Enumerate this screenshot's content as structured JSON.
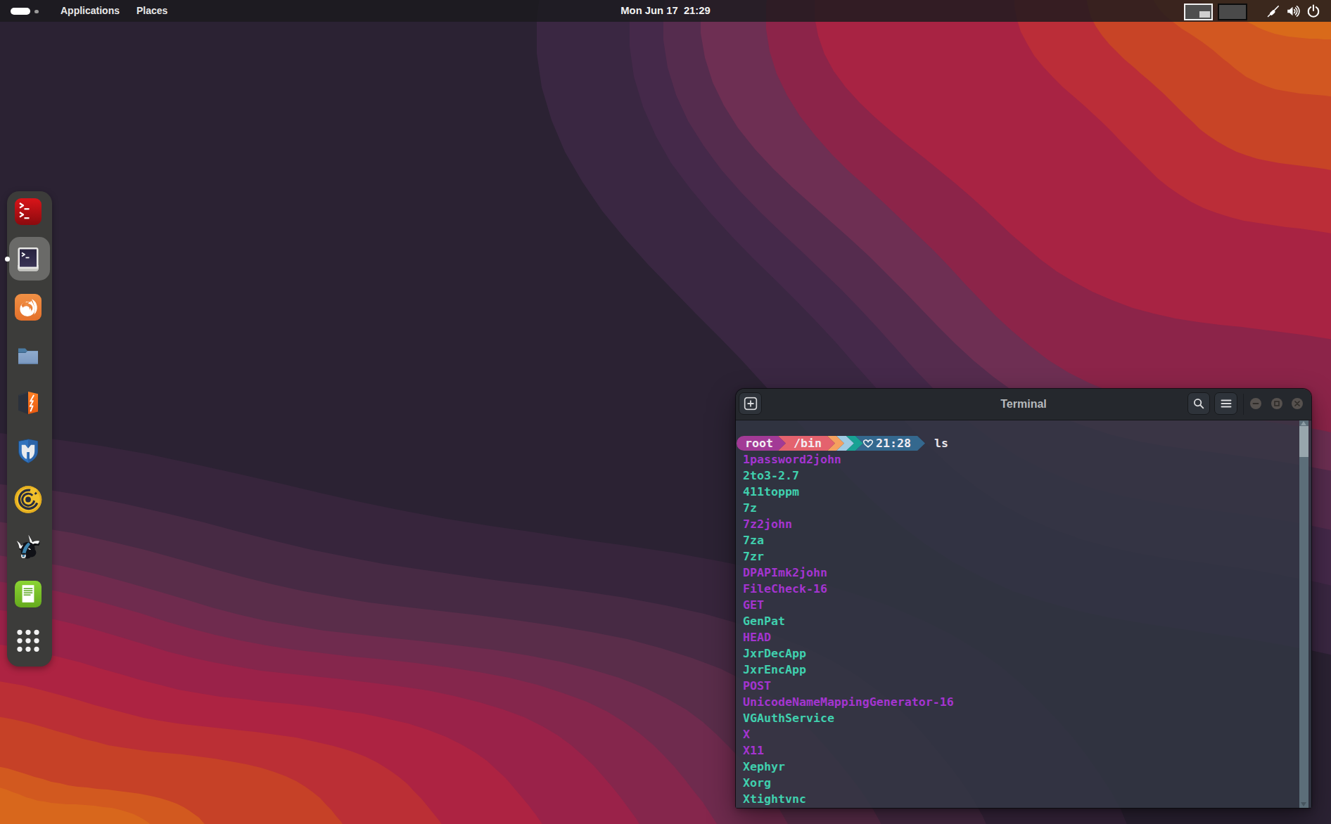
{
  "theme": {
    "panel_bg": "rgba(26,26,30,0.83)",
    "dock_bg": "#3c3c3a",
    "terminal_header_bg": "#25282d",
    "terminal_body_bg": "rgba(49,54,67,0.85)",
    "accent_magenta": "#a434d0",
    "accent_teal": "#40d0ae",
    "wallpaper_orange": "#dc7418",
    "wallpaper_crimson": "#a62343",
    "wallpaper_dark": "#2a2132"
  },
  "topbar": {
    "menus": [
      {
        "label": "Applications"
      },
      {
        "label": "Places"
      }
    ],
    "clock": "Mon Jun 17  21:29",
    "icons": [
      "stylus-icon",
      "volume-icon",
      "power-icon"
    ]
  },
  "dock": {
    "icons": [
      "root-terminal-icon",
      "terminal-icon",
      "firefox-icon",
      "files-icon",
      "burpsuite-icon",
      "metasploit-icon",
      "caido-icon",
      "beef-icon",
      "notes-icon",
      "show-apps-icon"
    ]
  },
  "terminal": {
    "title": "Terminal",
    "prompt": {
      "user": "root",
      "dir": "/bin",
      "heart": "♡",
      "time": "21:28",
      "command": "ls"
    },
    "files": [
      {
        "name": "1password2john",
        "color": "magenta"
      },
      {
        "name": "2to3-2.7",
        "color": "teal"
      },
      {
        "name": "411toppm",
        "color": "teal"
      },
      {
        "name": "7z",
        "color": "teal"
      },
      {
        "name": "7z2john",
        "color": "magenta"
      },
      {
        "name": "7za",
        "color": "teal"
      },
      {
        "name": "7zr",
        "color": "teal"
      },
      {
        "name": "DPAPImk2john",
        "color": "magenta"
      },
      {
        "name": "FileCheck-16",
        "color": "magenta"
      },
      {
        "name": "GET",
        "color": "magenta"
      },
      {
        "name": "GenPat",
        "color": "teal"
      },
      {
        "name": "HEAD",
        "color": "magenta"
      },
      {
        "name": "JxrDecApp",
        "color": "teal"
      },
      {
        "name": "JxrEncApp",
        "color": "teal"
      },
      {
        "name": "POST",
        "color": "magenta"
      },
      {
        "name": "UnicodeNameMappingGenerator-16",
        "color": "magenta"
      },
      {
        "name": "VGAuthService",
        "color": "teal"
      },
      {
        "name": "X",
        "color": "magenta"
      },
      {
        "name": "X11",
        "color": "magenta"
      },
      {
        "name": "Xephyr",
        "color": "teal"
      },
      {
        "name": "Xorg",
        "color": "teal"
      },
      {
        "name": "Xtightvnc",
        "color": "teal"
      }
    ]
  }
}
